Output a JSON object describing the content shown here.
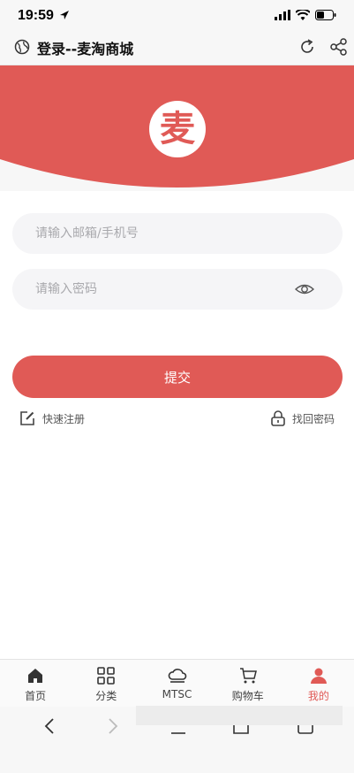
{
  "status_bar": {
    "time": "19:59"
  },
  "browser": {
    "title": "登录--麦淘商城"
  },
  "logo": {
    "text": "麦"
  },
  "form": {
    "email_placeholder": "请输入邮箱/手机号",
    "password_placeholder": "请输入密码",
    "submit_label": "提交",
    "register_link": "快速注册",
    "recover_link": "找回密码"
  },
  "tabs": [
    {
      "label": "首页",
      "icon": "home-icon"
    },
    {
      "label": "分类",
      "icon": "grid-icon"
    },
    {
      "label": "MTSC",
      "icon": "cloud-icon"
    },
    {
      "label": "购物车",
      "icon": "cart-icon"
    },
    {
      "label": "我的",
      "icon": "user-icon",
      "active": true
    }
  ],
  "colors": {
    "accent": "#e05a56",
    "field_bg": "#f5f5f7"
  }
}
